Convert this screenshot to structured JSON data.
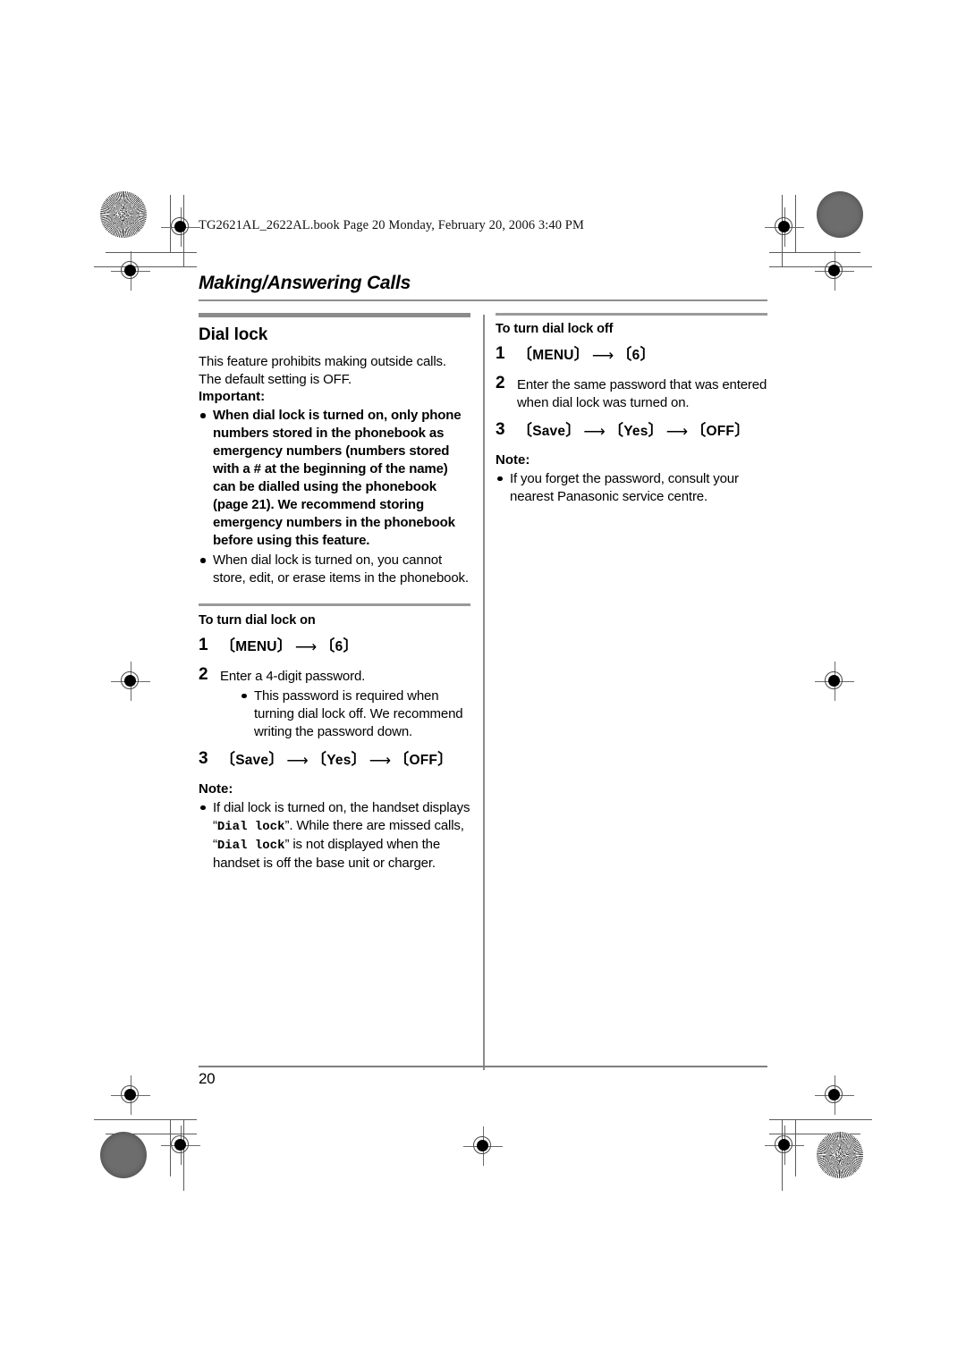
{
  "filestamp": "TG2621AL_2622AL.book  Page 20  Monday, February 20, 2006  3:40 PM",
  "header": {
    "chapter_title": "Making/Answering Calls"
  },
  "left_column": {
    "section_title": "Dial lock",
    "intro": "This feature prohibits making outside calls. The default setting is OFF.",
    "important_label": "Important:",
    "important_bullets": [
      "When dial lock is turned on, only phone numbers stored in the phonebook as emergency numbers (numbers stored with a # at the beginning of the name) can be dialled using the phonebook (page 21). We recommend storing emergency numbers in the phonebook before using this feature.",
      "When dial lock is turned on, you cannot store, edit, or erase items in the phonebook."
    ],
    "turn_on": {
      "heading": "To turn dial lock on",
      "step1": {
        "number": "1",
        "key1": "MENU",
        "key2": "6"
      },
      "step2": {
        "number": "2",
        "text": "Enter a 4-digit password.",
        "sub_bullets": [
          "This password is required when turning dial lock off. We recommend writing the password down."
        ]
      },
      "step3": {
        "number": "3",
        "key1": "Save",
        "key2": "Yes",
        "key3": "OFF"
      }
    },
    "note_label": "Note:",
    "note_bullet_parts": {
      "part1": "If dial lock is turned on, the handset displays “",
      "mono1": "Dial lock",
      "part2": "”. While there are missed calls, “",
      "mono2": "Dial lock",
      "part3": "” is not displayed when the handset is off the base unit or charger."
    }
  },
  "right_column": {
    "turn_off": {
      "heading": "To turn dial lock off",
      "step1": {
        "number": "1",
        "key1": "MENU",
        "key2": "6"
      },
      "step2": {
        "number": "2",
        "text": "Enter the same password that was entered when dial lock was turned on."
      },
      "step3": {
        "number": "3",
        "key1": "Save",
        "key2": "Yes",
        "key3": "OFF"
      }
    },
    "note_label": "Note:",
    "note_bullets": [
      "If you forget the password, consult your nearest Panasonic service centre."
    ]
  },
  "footer": {
    "page_number": "20"
  },
  "symbols": {
    "arrow": "⟶",
    "bracket_open": "〔",
    "bracket_close": "〕"
  }
}
